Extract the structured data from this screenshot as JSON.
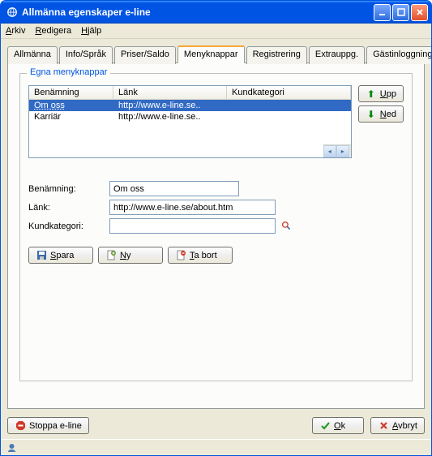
{
  "window": {
    "title": "Allmänna egenskaper e-line"
  },
  "menu": {
    "file": "Arkiv",
    "edit": "Redigera",
    "help": "Hjälp"
  },
  "tabs": {
    "allmanna": "Allmänna",
    "infosprak": "Info/Språk",
    "prisersaldo": "Priser/Saldo",
    "menyknappar": "Menyknappar",
    "registrering": "Registrering",
    "extrauppg": "Extrauppg.",
    "gastinloggningar": "Gästinloggningar"
  },
  "fieldset": {
    "legend": "Egna menyknappar"
  },
  "list": {
    "cols": {
      "name": "Benämning",
      "link": "Länk",
      "kat": "Kundkategori"
    },
    "rows": [
      {
        "name": "Om oss",
        "link": "http://www.e-line.se..",
        "kat": ""
      },
      {
        "name": "Karriär",
        "link": "http://www.e-line.se..",
        "kat": ""
      }
    ]
  },
  "buttons": {
    "up": "Upp",
    "ned": "Ned",
    "spara": "Spara",
    "ny": "Ny",
    "tabort": "Ta bort",
    "stoppa": "Stoppa e-line",
    "ok": "Ok",
    "avbryt": "Avbryt"
  },
  "form": {
    "benamning_label": "Benämning:",
    "benamning_value": "Om oss",
    "lank_label": "Länk:",
    "lank_value": "http://www.e-line.se/about.htm",
    "kundkategori_label": "Kundkategori:",
    "kundkategori_value": ""
  }
}
